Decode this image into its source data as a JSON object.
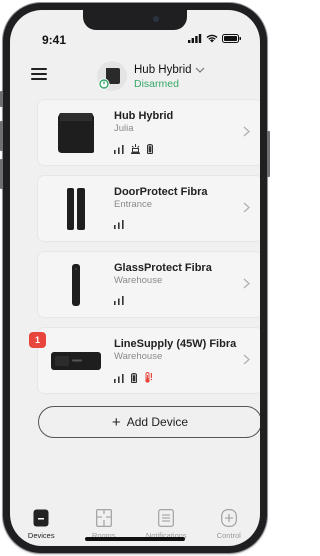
{
  "status_bar": {
    "time": "9:41"
  },
  "header": {
    "hub_name": "Hub Hybrid",
    "hub_state": "Disarmed"
  },
  "devices": [
    {
      "name": "Hub Hybrid",
      "room": "Julia",
      "icons": [
        "signal-icon",
        "tamper-icon",
        "battery-icon"
      ]
    },
    {
      "name": "DoorProtect Fibra",
      "room": "Entrance",
      "icons": [
        "signal-icon"
      ]
    },
    {
      "name": "GlassProtect Fibra",
      "room": "Warehouse",
      "icons": [
        "signal-icon"
      ]
    },
    {
      "name": "LineSupply (45W) Fibra",
      "room": "Warehouse",
      "icons": [
        "signal-icon",
        "battery-icon",
        "temperature-alert-icon"
      ],
      "alert_count": "1"
    }
  ],
  "add_device": {
    "label": "Add Device",
    "symbol": "+"
  },
  "tabs": [
    {
      "label": "Devices",
      "active": true
    },
    {
      "label": "Rooms",
      "active": false
    },
    {
      "label": "Notifications",
      "active": false
    },
    {
      "label": "Control",
      "active": false
    }
  ],
  "colors": {
    "accent_green": "#37a866",
    "alert_red": "#e8453c",
    "background": "#f0f0f0"
  }
}
